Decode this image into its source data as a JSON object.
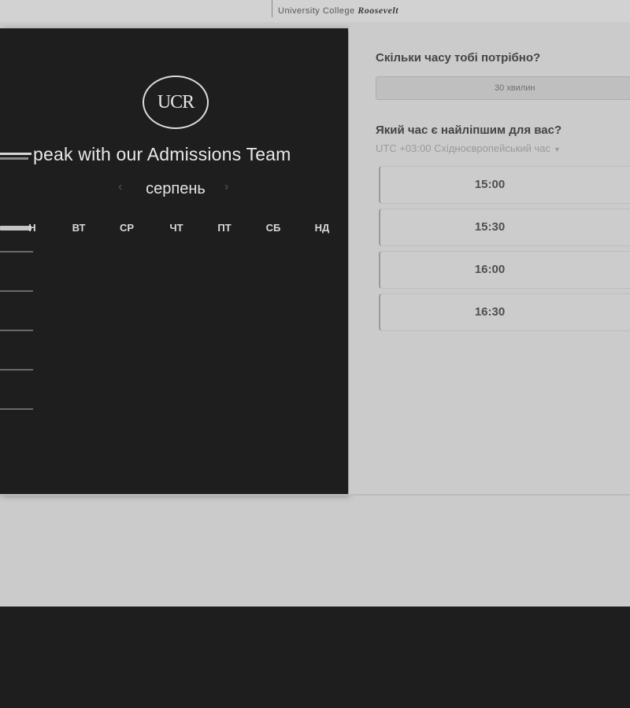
{
  "brand": {
    "caption_prefix": "University College",
    "caption_script": "Roosevelt"
  },
  "calendar": {
    "logo_text": "UCR",
    "title": "peak with our Admissions Team",
    "month": "серпень",
    "prev_icon": "‹",
    "next_icon": "›",
    "weekdays": [
      "Н",
      "ВТ",
      "СР",
      "ЧТ",
      "ПТ",
      "СБ",
      "НД"
    ]
  },
  "booking": {
    "duration_heading": "Скільки часу тобі потрібно?",
    "duration_value": "30 хвилин",
    "time_heading": "Який час є найліпшим для вас?",
    "timezone": "UTC +03:00 Східноєвропейський час",
    "timezone_caret": "▼",
    "slots": [
      "15:00",
      "15:30",
      "16:00",
      "16:30"
    ]
  },
  "colors": {
    "dark_panel": "#1e1e1e",
    "page_bg": "#cbcbcb",
    "footer": "#1e1e1e"
  }
}
